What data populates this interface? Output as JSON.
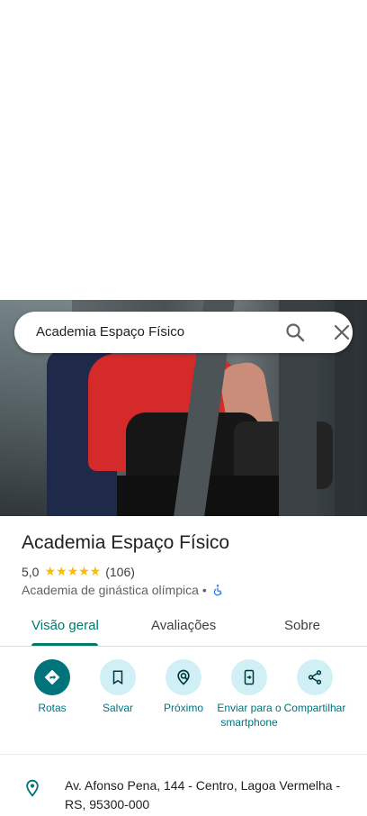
{
  "search": {
    "query": "Academia Espaço Físico"
  },
  "place": {
    "name": "Academia Espaço Físico",
    "rating": "5,0",
    "stars": "★★★★★",
    "reviews_count": "(106)",
    "category": "Academia de ginástica olímpica",
    "separator": "•"
  },
  "tabs": [
    {
      "label": "Visão geral",
      "active": true
    },
    {
      "label": "Avaliações",
      "active": false
    },
    {
      "label": "Sobre",
      "active": false
    }
  ],
  "actions": [
    {
      "label": "Rotas",
      "icon": "directions-icon"
    },
    {
      "label": "Salvar",
      "icon": "bookmark-icon"
    },
    {
      "label": "Próximo",
      "icon": "nearby-icon"
    },
    {
      "label": "Enviar para o smartphone",
      "icon": "send-to-phone-icon"
    },
    {
      "label": "Compartilhar",
      "icon": "share-icon"
    }
  ],
  "address": {
    "text": "Av. Afonso Pena, 144 - Centro, Lagoa Vermelha - RS, 95300-000"
  },
  "colors": {
    "accent": "#00796b",
    "action_fill": "#d1f0f6",
    "star": "#fbbc04"
  }
}
